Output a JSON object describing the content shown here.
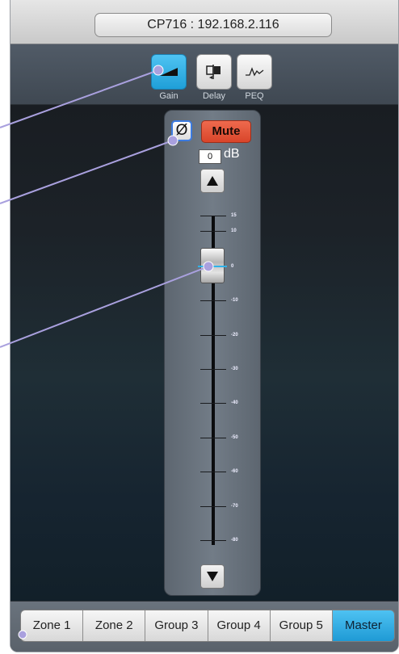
{
  "device": {
    "title": "CP716 : 192.168.2.116"
  },
  "toolbar": {
    "tools": [
      {
        "label": "Gain",
        "icon": "gain-ramp-icon",
        "active": true
      },
      {
        "label": "Delay",
        "icon": "delay-icon",
        "active": false
      },
      {
        "label": "PEQ",
        "icon": "peq-curve-icon",
        "active": false
      }
    ]
  },
  "channel": {
    "phase_symbol": "Ø",
    "mute_label": "Mute",
    "gain_value": "0",
    "gain_unit": "dB",
    "fader_level_db": 0,
    "scale_labels": [
      "15",
      "10",
      "0",
      "-10",
      "-20",
      "-30",
      "-40",
      "-50",
      "-60",
      "-70",
      "-80"
    ]
  },
  "zones": {
    "items": [
      "Zone 1",
      "Zone 2",
      "Group 3",
      "Group 4",
      "Group 5",
      "Master"
    ],
    "active": "Master"
  },
  "colors": {
    "accent_blue": "#2fb2ea",
    "mute_red": "#d9452a",
    "callout": "#a9a0de"
  }
}
